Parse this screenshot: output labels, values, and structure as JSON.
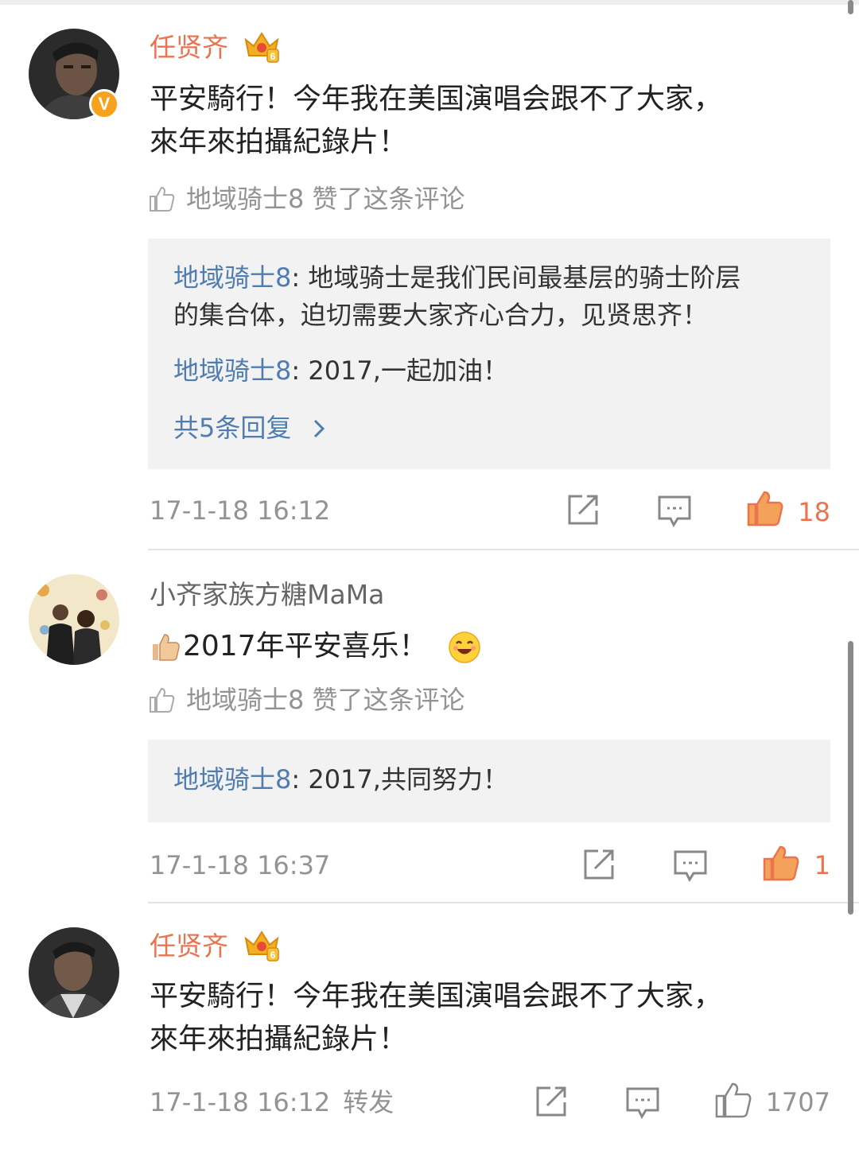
{
  "comments": [
    {
      "user": "任贤齐",
      "verified_badge": "V",
      "content_lines": [
        "平安騎行！今年我在美国演唱会跟不了大家，",
        "來年來拍攝紀錄片！"
      ],
      "liked_by": "地域骑士8 赞了这条评论",
      "replies": [
        {
          "author": "地域骑士8",
          "sep": ": ",
          "text_lines": [
            "地域骑士是我们民间最基层的骑士阶层",
            "的集合体，迫切需要大家齐心合力，见贤思齐！"
          ]
        },
        {
          "author": "地域骑士8",
          "sep": ": ",
          "text_lines": [
            "2017,一起加油！"
          ]
        }
      ],
      "more_replies": "共5条回复",
      "timestamp": "17-1-18 16:12",
      "likes": "18"
    },
    {
      "user": "小齐家族方糖MaMa",
      "content": "2017年平安喜乐！",
      "liked_by": "地域骑士8 赞了这条评论",
      "replies": [
        {
          "author": "地域骑士8",
          "sep": ": ",
          "text_lines": [
            "2017,共同努力！"
          ]
        }
      ],
      "timestamp": "17-1-18 16:37",
      "likes": "1"
    },
    {
      "user": "任贤齐",
      "content_lines": [
        "平安騎行！今年我在美国演唱会跟不了大家，",
        "來年來拍攝紀錄片！"
      ],
      "timestamp": "17-1-18 16:12",
      "repost_label": "转发",
      "likes": "1707"
    }
  ],
  "icons": {
    "share": "repost-icon",
    "reply": "comment-icon",
    "like": "thumbs-up-icon",
    "crown": "crown-vip-icon"
  },
  "colors": {
    "vip_name": "#eb7350",
    "link": "#507daf",
    "muted": "#939393",
    "reply_bg": "#f2f2f2",
    "like_active": "#eb7350"
  }
}
